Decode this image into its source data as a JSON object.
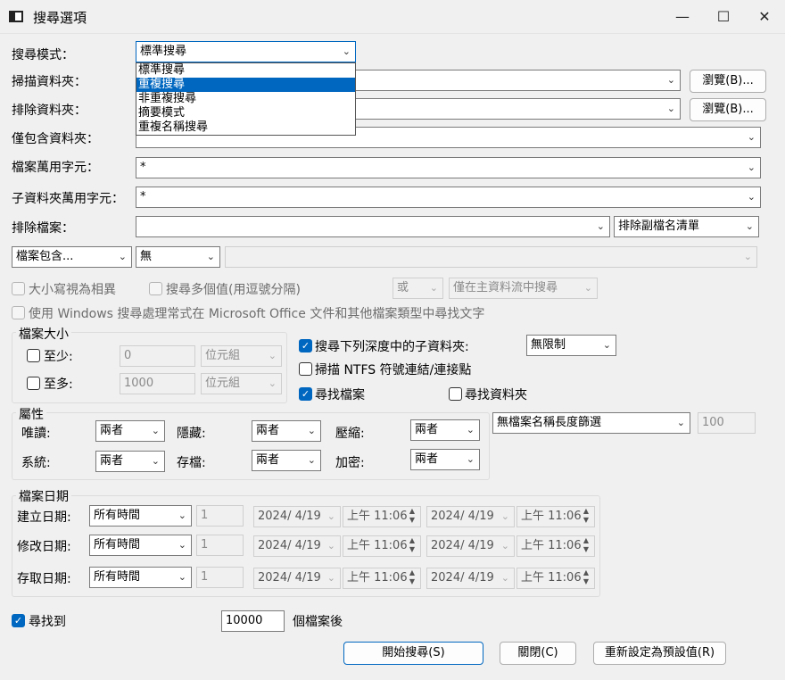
{
  "window": {
    "title": "搜尋選項",
    "minimize": "—",
    "maximize": "☐",
    "close": "✕"
  },
  "labels": {
    "search_mode": "搜尋模式：",
    "scan_folder": "掃描資料夾：",
    "exclude_folder": "排除資料夾：",
    "include_only_folder": "僅包含資料夾：",
    "file_wildcard": "檔案萬用字元：",
    "subfolder_wildcard": "子資料夾萬用字元：",
    "exclude_files": "排除檔案："
  },
  "search_mode": {
    "selected": "標準搜尋",
    "options": [
      "標準搜尋",
      "重複搜尋",
      "非重複搜尋",
      "摘要模式",
      "重複名稱搜尋"
    ],
    "highlighted_index": 1
  },
  "browse_button": "瀏覽(B)...",
  "fields": {
    "scan_folder": "",
    "exclude_folder": "",
    "include_only_folder": "",
    "file_wildcard": "*",
    "subfolder_wildcard": "*",
    "exclude_files": "",
    "exclude_ext": "排除副檔名清單"
  },
  "content_row": {
    "file_contains": "檔案包含...",
    "contains_type": "無",
    "contains_text": ""
  },
  "options_row1": {
    "case_sensitive": "大小寫視為相異",
    "multi_values": "搜尋多個值(用逗號分隔)",
    "or_combo": "或",
    "main_stream": "僅在主資料流中搜尋"
  },
  "windows_search": "使用 Windows 搜尋處理常式在 Microsoft Office 文件和其他檔案類型中尋找文字",
  "file_size": {
    "title": "檔案大小",
    "at_least": "至少:",
    "at_least_value": "0",
    "at_most": "至多:",
    "at_most_value": "1000",
    "unit": "位元組"
  },
  "subfolder_depth": {
    "label": "搜尋下列深度中的子資料夾:",
    "value": "無限制"
  },
  "scan_ntfs": "掃描 NTFS 符號連結/連接點",
  "find_files": "尋找檔案",
  "find_folders": "尋找資料夾",
  "attributes": {
    "title": "屬性",
    "readonly": "唯讀:",
    "hidden": "隱藏:",
    "compressed": "壓縮:",
    "system": "系統:",
    "archive": "存檔:",
    "encrypted": "加密:",
    "both": "兩者"
  },
  "name_length_filter": {
    "value": "無檔案名稱長度篩選",
    "number": "100"
  },
  "file_date": {
    "title": "檔案日期",
    "rows": [
      {
        "label": "建立日期:",
        "range": "所有時間",
        "count": "1",
        "date1": "2024/ 4/19",
        "time1": "上午 11:06",
        "date2": "2024/ 4/19",
        "time2": "上午 11:06"
      },
      {
        "label": "修改日期:",
        "range": "所有時間",
        "count": "1",
        "date1": "2024/ 4/19",
        "time1": "上午 11:06",
        "date2": "2024/ 4/19",
        "time2": "上午 11:06"
      },
      {
        "label": "存取日期:",
        "range": "所有時間",
        "count": "1",
        "date1": "2024/ 4/19",
        "time1": "上午 11:06",
        "date2": "2024/ 4/19",
        "time2": "上午 11:06"
      }
    ]
  },
  "find_limit": {
    "label": "尋找到",
    "value": "10000",
    "suffix": "個檔案後"
  },
  "buttons": {
    "start": "開始搜尋(S)",
    "close": "關閉(C)",
    "reset": "重新設定為預設值(R)"
  }
}
